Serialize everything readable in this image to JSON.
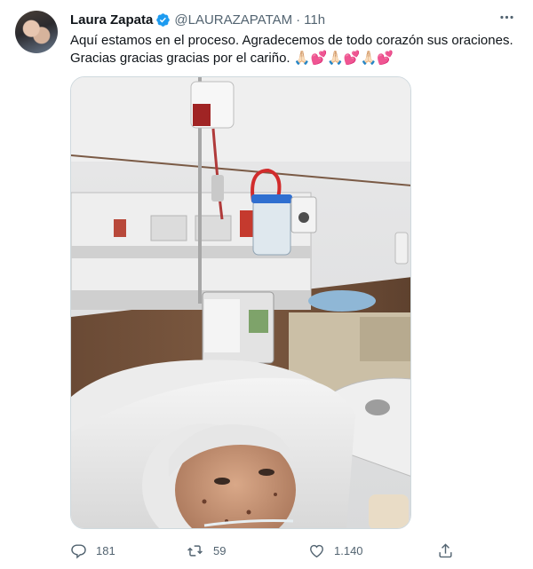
{
  "tweet": {
    "author_name": "Laura Zapata",
    "handle": "@LAURAZAPATAM",
    "separator": "·",
    "time": "11h",
    "text_line1": "Aquí estamos en el proceso. Agradecemos de todo corazón sus oraciones.",
    "text_line2": "Gracias gracias gracias por el cariño. 🙏🏻💕🙏🏻💕🙏🏻💕"
  },
  "actions": {
    "replies": "181",
    "retweets": "59",
    "likes": "1.140"
  },
  "colors": {
    "verified": "#1d9bf0",
    "secondary_text": "#536471",
    "border": "#cfd9de"
  },
  "icons": [
    "verified-badge-icon",
    "more-icon",
    "reply-icon",
    "retweet-icon",
    "like-icon",
    "share-icon"
  ]
}
